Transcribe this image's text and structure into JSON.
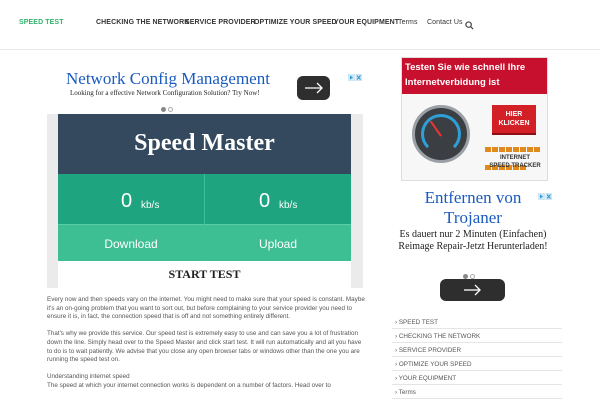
{
  "nav": {
    "items": [
      {
        "label": "SPEED TEST",
        "active": true
      },
      {
        "label": "CHECKING THE NETWORK"
      },
      {
        "label": "SERVICE PROVIDER"
      },
      {
        "label": "OPTIMIZE YOUR SPEED"
      },
      {
        "label": "YOUR EQUIPMENT"
      },
      {
        "label": "Terms"
      },
      {
        "label": "Contact Us"
      }
    ],
    "search_icon": "search-icon"
  },
  "ad_top": {
    "title": "Network Config Management",
    "subtitle": "Looking for a effective Network Configuration Solution? Try Now!",
    "button_icon": "arrow-right-icon"
  },
  "speed_master": {
    "title": "Speed Master",
    "download_value": "0",
    "download_unit": "kb/s",
    "upload_value": "0",
    "upload_unit": "kb/s",
    "download_label": "Download",
    "upload_label": "Upload",
    "start_label": "START TEST"
  },
  "article": {
    "p1": "Every now and then speeds vary on the internet. You might need to make sure that your speed is constant. Maybe it's an on-going problem that you want to sort out, but before complaining to your service provider you need to ensure it is, in fact, the connection speed that is off and not something entirely different.",
    "p2": "That's why we provide this service. Our speed test is extremely easy to use and can save you a lot of frustration down the line. Simply head over to the Speed Master and click start test. It will run automatically and all you have to do is to wait patiently. We advise that you close any open browser tabs or windows other than the one you are running the speed test on.",
    "heading": "Understanding internet speed",
    "p3": "The speed at which your internet connection works is dependent on a number of factors. Head over to"
  },
  "ad_image": {
    "headline_line1": "Testen Sie wie schnell Ihre",
    "headline_line2": "Internetverbidung ist",
    "button": "HIER KLICKEN",
    "caption_line1": "INTERNET",
    "caption_line2": "SPEED TRACKER"
  },
  "ad_text": {
    "title": "Entfernen von Trojaner",
    "body": "Es dauert nur 2 Minuten (Einfachen) Reimage Repair-Jetzt Herunterladen!",
    "button_icon": "arrow-right-icon"
  },
  "sidebar": {
    "items": [
      {
        "label": "SPEED TEST"
      },
      {
        "label": "CHECKING THE NETWORK"
      },
      {
        "label": "SERVICE PROVIDER"
      },
      {
        "label": "OPTIMIZE YOUR SPEED"
      },
      {
        "label": "YOUR EQUIPMENT"
      },
      {
        "label": "Terms"
      }
    ]
  },
  "colors": {
    "accent_green": "#2fb36b",
    "header_dark": "#34495e",
    "gauge_teal": "#1ea57f",
    "button_green": "#3ebe93",
    "ad_link_blue": "#1a5bbf",
    "ad_red": "#c7102e"
  }
}
